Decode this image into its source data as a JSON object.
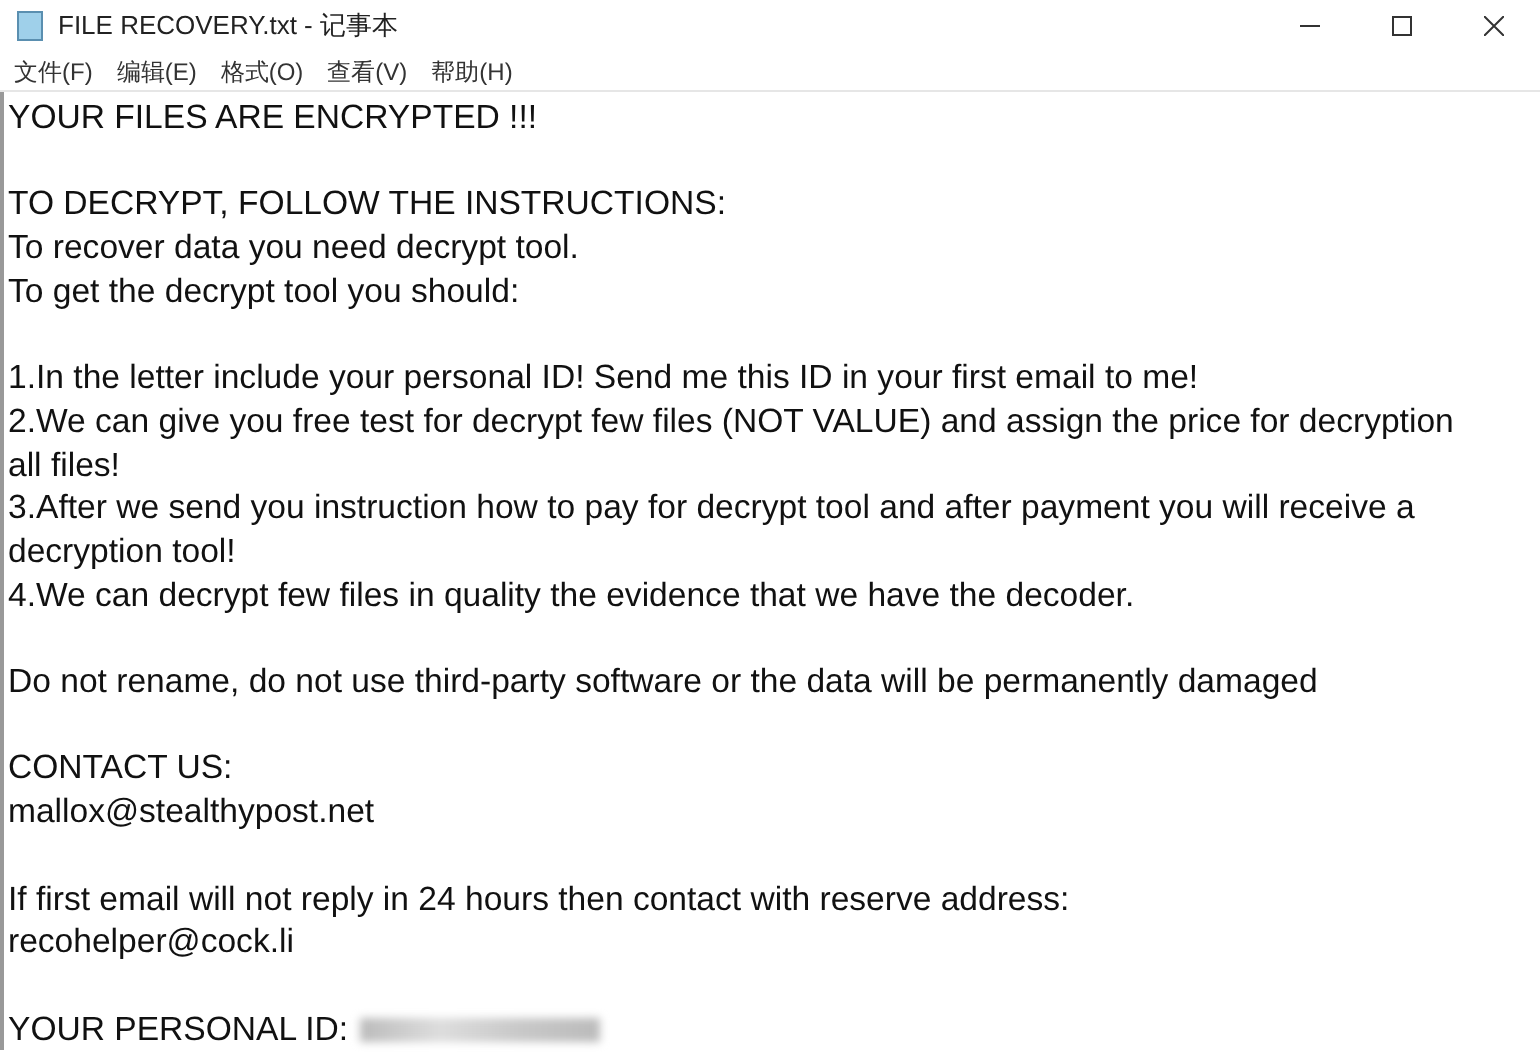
{
  "window": {
    "title": "FILE RECOVERY.txt - 记事本"
  },
  "menu": [
    "文件(F)",
    "编辑(E)",
    "格式(O)",
    "查看(V)",
    "帮助(H)"
  ],
  "paragraphs": [
    [
      "YOUR FILES ARE ENCRYPTED !!!"
    ],
    [
      "TO DECRYPT, FOLLOW THE INSTRUCTIONS:",
      "To recover data you need decrypt tool.",
      "To get the decrypt tool you should:"
    ],
    [
      "1.In the letter include your personal ID! Send me this ID in your first email to me!",
      "2.We can give you free test for decrypt few files (NOT VALUE) and assign the price for decryption",
      "all files!",
      "3.After we send you instruction how to pay for decrypt tool and after payment you will receive a",
      "decryption tool!",
      "4.We can decrypt few files in quality the evidence that we have the decoder."
    ],
    [
      "Do not rename, do not use third-party software or the data will be permanently damaged"
    ],
    [
      "CONTACT US:",
      "mallox@stealthypost.net"
    ],
    [
      "If first email will not reply in 24 hours then contact with reserve address:",
      "recohelper@cock.li"
    ],
    [
      "YOUR PERSONAL ID:"
    ]
  ],
  "personal_id": {
    "redacted": true
  }
}
